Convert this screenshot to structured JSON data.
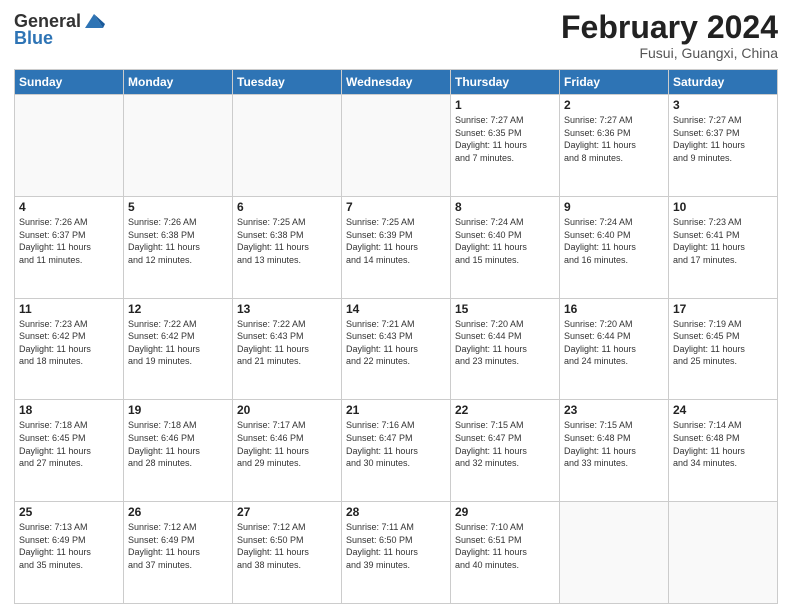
{
  "header": {
    "logo_general": "General",
    "logo_blue": "Blue",
    "month_year": "February 2024",
    "location": "Fusui, Guangxi, China"
  },
  "days_of_week": [
    "Sunday",
    "Monday",
    "Tuesday",
    "Wednesday",
    "Thursday",
    "Friday",
    "Saturday"
  ],
  "weeks": [
    [
      {
        "day": "",
        "info": ""
      },
      {
        "day": "",
        "info": ""
      },
      {
        "day": "",
        "info": ""
      },
      {
        "day": "",
        "info": ""
      },
      {
        "day": "1",
        "info": "Sunrise: 7:27 AM\nSunset: 6:35 PM\nDaylight: 11 hours\nand 7 minutes."
      },
      {
        "day": "2",
        "info": "Sunrise: 7:27 AM\nSunset: 6:36 PM\nDaylight: 11 hours\nand 8 minutes."
      },
      {
        "day": "3",
        "info": "Sunrise: 7:27 AM\nSunset: 6:37 PM\nDaylight: 11 hours\nand 9 minutes."
      }
    ],
    [
      {
        "day": "4",
        "info": "Sunrise: 7:26 AM\nSunset: 6:37 PM\nDaylight: 11 hours\nand 11 minutes."
      },
      {
        "day": "5",
        "info": "Sunrise: 7:26 AM\nSunset: 6:38 PM\nDaylight: 11 hours\nand 12 minutes."
      },
      {
        "day": "6",
        "info": "Sunrise: 7:25 AM\nSunset: 6:38 PM\nDaylight: 11 hours\nand 13 minutes."
      },
      {
        "day": "7",
        "info": "Sunrise: 7:25 AM\nSunset: 6:39 PM\nDaylight: 11 hours\nand 14 minutes."
      },
      {
        "day": "8",
        "info": "Sunrise: 7:24 AM\nSunset: 6:40 PM\nDaylight: 11 hours\nand 15 minutes."
      },
      {
        "day": "9",
        "info": "Sunrise: 7:24 AM\nSunset: 6:40 PM\nDaylight: 11 hours\nand 16 minutes."
      },
      {
        "day": "10",
        "info": "Sunrise: 7:23 AM\nSunset: 6:41 PM\nDaylight: 11 hours\nand 17 minutes."
      }
    ],
    [
      {
        "day": "11",
        "info": "Sunrise: 7:23 AM\nSunset: 6:42 PM\nDaylight: 11 hours\nand 18 minutes."
      },
      {
        "day": "12",
        "info": "Sunrise: 7:22 AM\nSunset: 6:42 PM\nDaylight: 11 hours\nand 19 minutes."
      },
      {
        "day": "13",
        "info": "Sunrise: 7:22 AM\nSunset: 6:43 PM\nDaylight: 11 hours\nand 21 minutes."
      },
      {
        "day": "14",
        "info": "Sunrise: 7:21 AM\nSunset: 6:43 PM\nDaylight: 11 hours\nand 22 minutes."
      },
      {
        "day": "15",
        "info": "Sunrise: 7:20 AM\nSunset: 6:44 PM\nDaylight: 11 hours\nand 23 minutes."
      },
      {
        "day": "16",
        "info": "Sunrise: 7:20 AM\nSunset: 6:44 PM\nDaylight: 11 hours\nand 24 minutes."
      },
      {
        "day": "17",
        "info": "Sunrise: 7:19 AM\nSunset: 6:45 PM\nDaylight: 11 hours\nand 25 minutes."
      }
    ],
    [
      {
        "day": "18",
        "info": "Sunrise: 7:18 AM\nSunset: 6:45 PM\nDaylight: 11 hours\nand 27 minutes."
      },
      {
        "day": "19",
        "info": "Sunrise: 7:18 AM\nSunset: 6:46 PM\nDaylight: 11 hours\nand 28 minutes."
      },
      {
        "day": "20",
        "info": "Sunrise: 7:17 AM\nSunset: 6:46 PM\nDaylight: 11 hours\nand 29 minutes."
      },
      {
        "day": "21",
        "info": "Sunrise: 7:16 AM\nSunset: 6:47 PM\nDaylight: 11 hours\nand 30 minutes."
      },
      {
        "day": "22",
        "info": "Sunrise: 7:15 AM\nSunset: 6:47 PM\nDaylight: 11 hours\nand 32 minutes."
      },
      {
        "day": "23",
        "info": "Sunrise: 7:15 AM\nSunset: 6:48 PM\nDaylight: 11 hours\nand 33 minutes."
      },
      {
        "day": "24",
        "info": "Sunrise: 7:14 AM\nSunset: 6:48 PM\nDaylight: 11 hours\nand 34 minutes."
      }
    ],
    [
      {
        "day": "25",
        "info": "Sunrise: 7:13 AM\nSunset: 6:49 PM\nDaylight: 11 hours\nand 35 minutes."
      },
      {
        "day": "26",
        "info": "Sunrise: 7:12 AM\nSunset: 6:49 PM\nDaylight: 11 hours\nand 37 minutes."
      },
      {
        "day": "27",
        "info": "Sunrise: 7:12 AM\nSunset: 6:50 PM\nDaylight: 11 hours\nand 38 minutes."
      },
      {
        "day": "28",
        "info": "Sunrise: 7:11 AM\nSunset: 6:50 PM\nDaylight: 11 hours\nand 39 minutes."
      },
      {
        "day": "29",
        "info": "Sunrise: 7:10 AM\nSunset: 6:51 PM\nDaylight: 11 hours\nand 40 minutes."
      },
      {
        "day": "",
        "info": ""
      },
      {
        "day": "",
        "info": ""
      }
    ]
  ]
}
